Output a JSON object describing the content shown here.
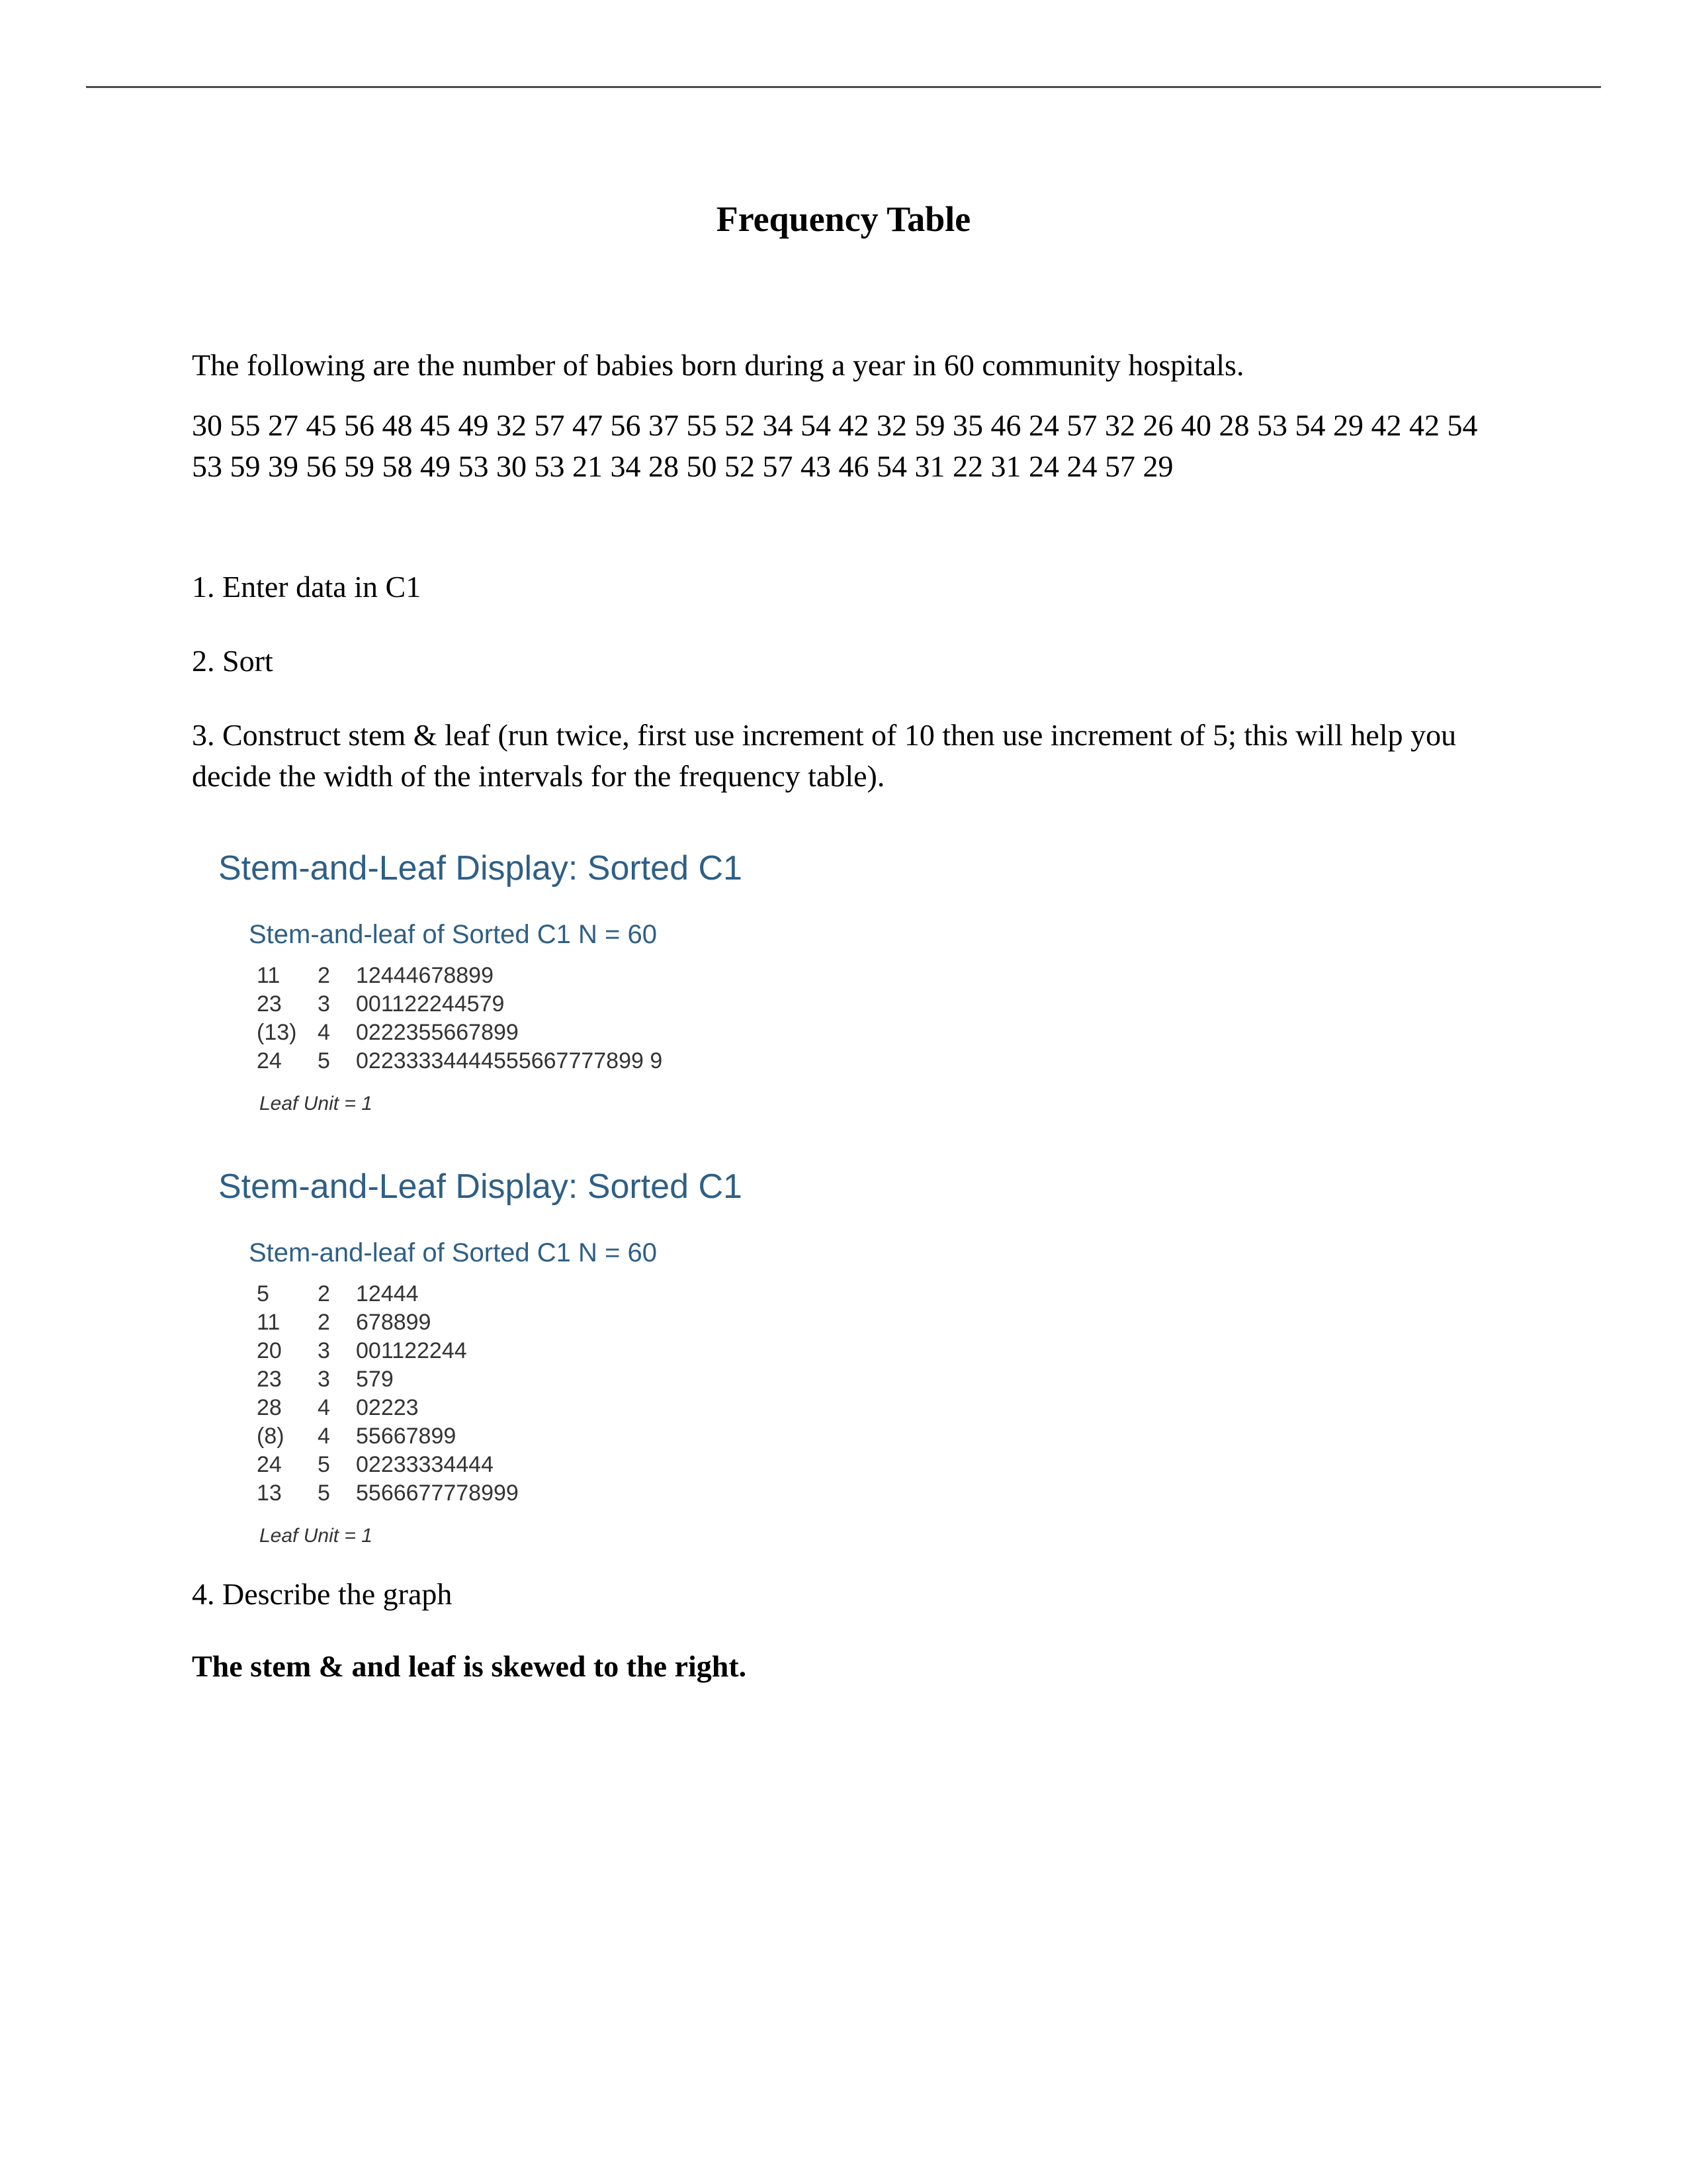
{
  "title": "Frequency Table",
  "intro": "The following are the number of babies born during a year in 60 community hospitals.",
  "numbers": "30 55 27 45 56 48 45 49 32 57 47 56 37 55 52 34 54 42 32 59 35 46 24 57 32 26 40 28 53 54 29 42 42 54 53 59 39 56 59 58 49 53 30 53 21 34 28 50 52 57 43 46 54 31 22 31 24 24 57 29",
  "steps": {
    "s1": "1. Enter data in C1",
    "s2": "2. Sort",
    "s3": "3. Construct stem & leaf (run twice, first use increment of 10 then use increment of 5; this will help you decide the width of the intervals for the frequency table)."
  },
  "panel1": {
    "title": "Stem-and-Leaf Display: Sorted C1",
    "sub": "Stem-and-leaf of Sorted C1   N = 60",
    "rows": [
      {
        "depth": "11",
        "stem": "2",
        "leaves": "12444678899"
      },
      {
        "depth": "23",
        "stem": "3",
        "leaves": "001122244579"
      },
      {
        "depth": "(13)",
        "stem": "4",
        "leaves": "0222355667899"
      },
      {
        "depth": "24",
        "stem": "5",
        "leaves": "02233334444555667777899 9"
      }
    ],
    "leaf_unit": "Leaf Unit = 1"
  },
  "panel2": {
    "title": "Stem-and-Leaf Display: Sorted C1",
    "sub": "Stem-and-leaf of Sorted C1   N = 60",
    "rows": [
      {
        "depth": "5",
        "stem": "2",
        "leaves": "12444"
      },
      {
        "depth": "11",
        "stem": "2",
        "leaves": "678899"
      },
      {
        "depth": "20",
        "stem": "3",
        "leaves": "001122244"
      },
      {
        "depth": "23",
        "stem": "3",
        "leaves": "579"
      },
      {
        "depth": "28",
        "stem": "4",
        "leaves": "02223"
      },
      {
        "depth": "(8)",
        "stem": "4",
        "leaves": "55667899"
      },
      {
        "depth": "24",
        "stem": "5",
        "leaves": "02233334444"
      },
      {
        "depth": "13",
        "stem": "5",
        "leaves": "5566677778999"
      }
    ],
    "leaf_unit": "Leaf Unit = 1"
  },
  "describe": "4. Describe the graph",
  "conclusion": "The stem & and leaf is skewed to the right."
}
